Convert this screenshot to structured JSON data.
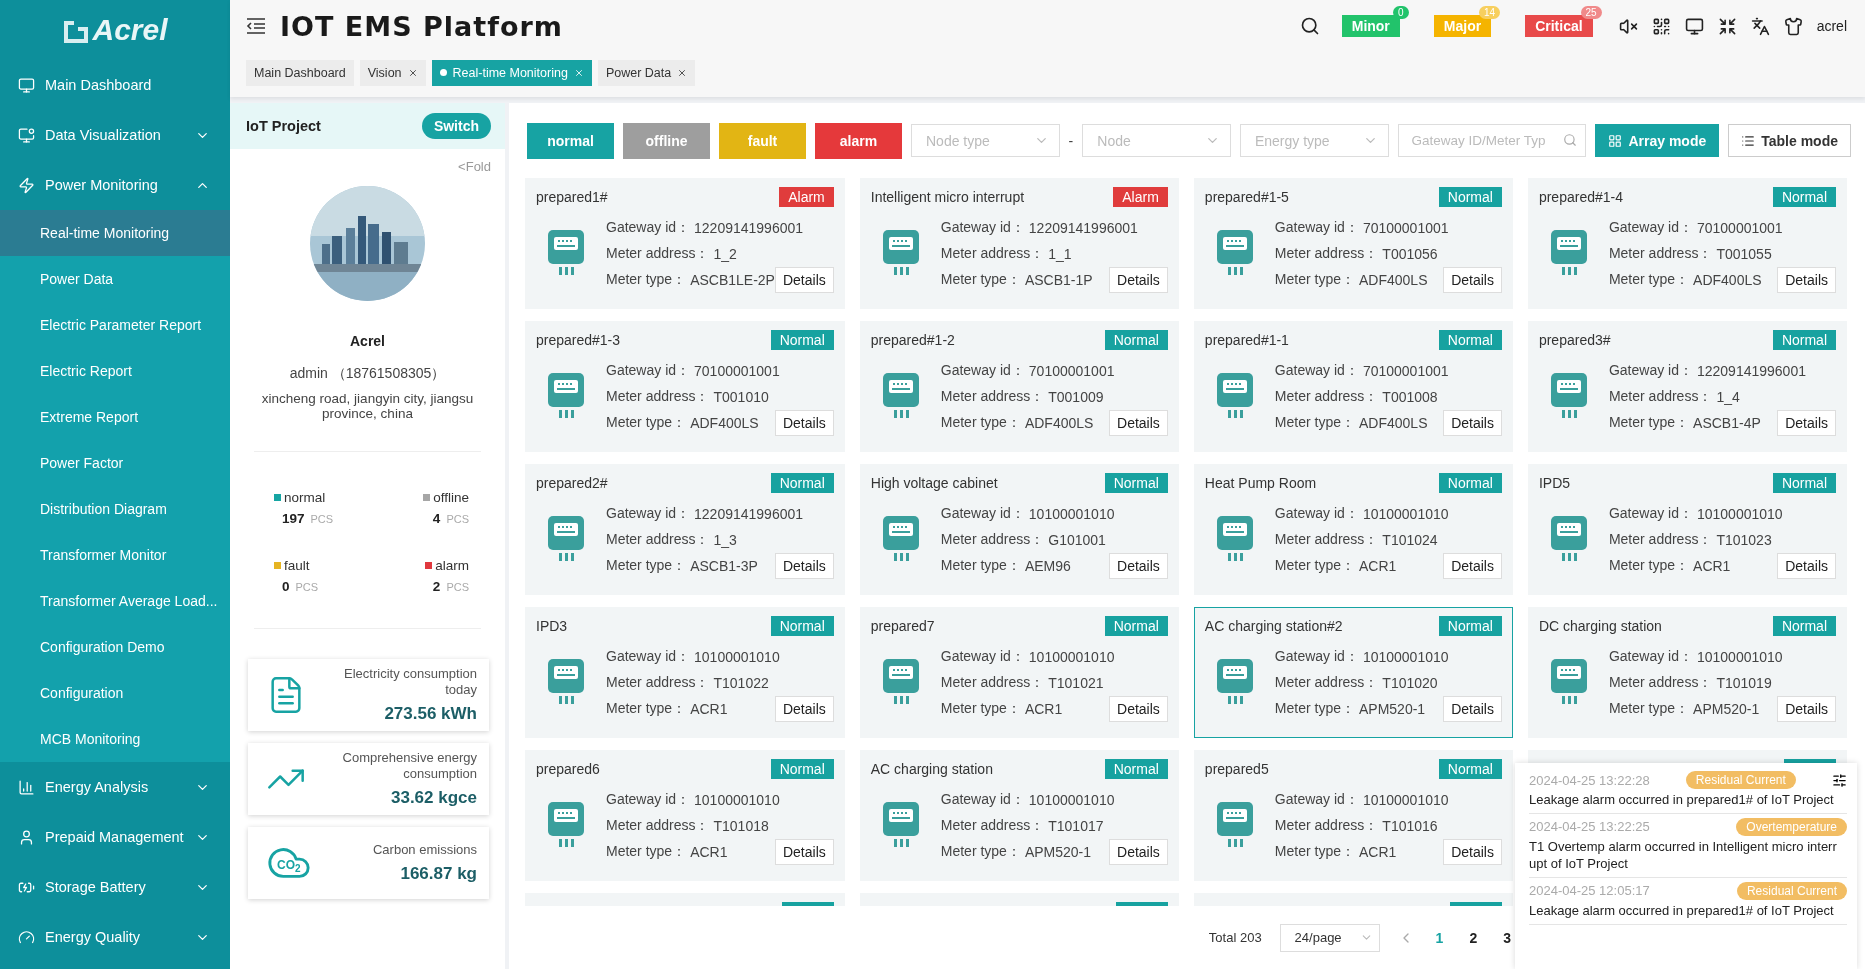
{
  "sidebar": {
    "logo": "Acrel",
    "items": [
      {
        "label": "Main Dashboard",
        "kind": "link"
      },
      {
        "label": "Data Visualization",
        "kind": "group",
        "expanded": false
      },
      {
        "label": "Power Monitoring",
        "kind": "group",
        "expanded": true,
        "children": [
          {
            "label": "Real-time Monitoring",
            "selected": true
          },
          {
            "label": "Power Data",
            "selected": false
          },
          {
            "label": "Electric Parameter Report",
            "selected": false
          },
          {
            "label": "Electric Report",
            "selected": false
          },
          {
            "label": "Extreme Report",
            "selected": false
          },
          {
            "label": "Power Factor",
            "selected": false
          },
          {
            "label": "Distribution Diagram",
            "selected": false
          },
          {
            "label": "Transformer Monitor",
            "selected": false
          },
          {
            "label": "Transformer Average Load...",
            "selected": false
          },
          {
            "label": "Configuration Demo",
            "selected": false
          },
          {
            "label": "Configuration",
            "selected": false
          },
          {
            "label": "MCB Monitoring",
            "selected": false
          }
        ]
      },
      {
        "label": "Energy Analysis",
        "kind": "group",
        "expanded": false
      },
      {
        "label": "Prepaid Management",
        "kind": "group",
        "expanded": false
      },
      {
        "label": "Storage Battery",
        "kind": "group",
        "expanded": false
      },
      {
        "label": "Energy Quality",
        "kind": "group",
        "expanded": false
      }
    ]
  },
  "header": {
    "title": "IOT EMS Platform",
    "alarms": [
      {
        "kind": "minor",
        "label": "Minor",
        "count": "0"
      },
      {
        "kind": "major",
        "label": "Major",
        "count": "14"
      },
      {
        "kind": "critical",
        "label": "Critical",
        "count": "25"
      }
    ],
    "user": "acrel"
  },
  "tabs": [
    {
      "label": "Main Dashboard",
      "selected": false,
      "closable": false
    },
    {
      "label": "Vision",
      "selected": false,
      "closable": true
    },
    {
      "label": "Real-time Monitoring",
      "selected": true,
      "closable": true
    },
    {
      "label": "Power Data",
      "selected": false,
      "closable": true
    }
  ],
  "project": {
    "title": "IoT Project",
    "switch": "Switch",
    "fold": "<Fold",
    "name": "Acrel",
    "contact": "admin （18761508305）",
    "address": "xincheng road, jiangyin city, jiangsu province, china",
    "counts": [
      {
        "label": "normal",
        "color": "#16a5a3",
        "value": "197",
        "unit": "PCS"
      },
      {
        "label": "offline",
        "color": "#a6a6a6",
        "value": "4",
        "unit": "PCS"
      },
      {
        "label": "fault",
        "color": "#e6b422",
        "value": "0",
        "unit": "PCS"
      },
      {
        "label": "alarm",
        "color": "#e0383e",
        "value": "2",
        "unit": "PCS"
      }
    ],
    "stats": [
      {
        "kind": "electricity",
        "label": "Electricity consumption today",
        "value": "273.56 kWh"
      },
      {
        "kind": "energy",
        "label": "Comprehensive energy consumption",
        "value": "33.62 kgce"
      },
      {
        "kind": "carbon",
        "label": "Carbon emissions",
        "value": "166.87 kg",
        "icon_text": "CO$_{2}$"
      }
    ]
  },
  "filters": {
    "status_buttons": [
      {
        "kind": "normal",
        "label": "normal"
      },
      {
        "kind": "offline",
        "label": "offline"
      },
      {
        "kind": "fault",
        "label": "fault"
      },
      {
        "kind": "alarm",
        "label": "alarm"
      }
    ],
    "node_type": {
      "placeholder": "Node type"
    },
    "separator": "-",
    "node": {
      "placeholder": "Node"
    },
    "energy_type": {
      "placeholder": "Energy type"
    },
    "search": {
      "placeholder": "Gateway ID/Meter Typ"
    },
    "modes": [
      {
        "label": "Array mode",
        "selected": true
      },
      {
        "label": "Table mode",
        "selected": false
      }
    ]
  },
  "cards": [
    {
      "title": "prepared1#",
      "status": {
        "kind": "alarm",
        "label": "Alarm"
      },
      "selected": false,
      "fields": [
        {
          "label": "Gateway id：",
          "value": "12209141996001"
        },
        {
          "label": "Meter address：",
          "value": "1_2"
        },
        {
          "label": "Meter type：",
          "value": "ASCB1LE-2P"
        }
      ],
      "button": "Details"
    },
    {
      "title": "Intelligent micro interrupt",
      "status": {
        "kind": "alarm",
        "label": "Alarm"
      },
      "selected": false,
      "fields": [
        {
          "label": "Gateway id：",
          "value": "12209141996001"
        },
        {
          "label": "Meter address：",
          "value": "1_1"
        },
        {
          "label": "Meter type：",
          "value": "ASCB1-1P"
        }
      ],
      "button": "Details"
    },
    {
      "title": "prepared#1-5",
      "status": {
        "kind": "normal",
        "label": "Normal"
      },
      "selected": false,
      "fields": [
        {
          "label": "Gateway id：",
          "value": "70100001001"
        },
        {
          "label": "Meter address：",
          "value": "T001056"
        },
        {
          "label": "Meter type：",
          "value": "ADF400LS"
        }
      ],
      "button": "Details"
    },
    {
      "title": "prepared#1-4",
      "status": {
        "kind": "normal",
        "label": "Normal"
      },
      "selected": false,
      "fields": [
        {
          "label": "Gateway id：",
          "value": "70100001001"
        },
        {
          "label": "Meter address：",
          "value": "T001055"
        },
        {
          "label": "Meter type：",
          "value": "ADF400LS"
        }
      ],
      "button": "Details"
    },
    {
      "title": "prepared#1-3",
      "status": {
        "kind": "normal",
        "label": "Normal"
      },
      "selected": false,
      "fields": [
        {
          "label": "Gateway id：",
          "value": "70100001001"
        },
        {
          "label": "Meter address：",
          "value": "T001010"
        },
        {
          "label": "Meter type：",
          "value": "ADF400LS"
        }
      ],
      "button": "Details"
    },
    {
      "title": "prepared#1-2",
      "status": {
        "kind": "normal",
        "label": "Normal"
      },
      "selected": false,
      "fields": [
        {
          "label": "Gateway id：",
          "value": "70100001001"
        },
        {
          "label": "Meter address：",
          "value": "T001009"
        },
        {
          "label": "Meter type：",
          "value": "ADF400LS"
        }
      ],
      "button": "Details"
    },
    {
      "title": "prepared#1-1",
      "status": {
        "kind": "normal",
        "label": "Normal"
      },
      "selected": false,
      "fields": [
        {
          "label": "Gateway id：",
          "value": "70100001001"
        },
        {
          "label": "Meter address：",
          "value": "T001008"
        },
        {
          "label": "Meter type：",
          "value": "ADF400LS"
        }
      ],
      "button": "Details"
    },
    {
      "title": "prepared3#",
      "status": {
        "kind": "normal",
        "label": "Normal"
      },
      "selected": false,
      "fields": [
        {
          "label": "Gateway id：",
          "value": "12209141996001"
        },
        {
          "label": "Meter address：",
          "value": "1_4"
        },
        {
          "label": "Meter type：",
          "value": "ASCB1-4P"
        }
      ],
      "button": "Details"
    },
    {
      "title": "prepared2#",
      "status": {
        "kind": "normal",
        "label": "Normal"
      },
      "selected": false,
      "fields": [
        {
          "label": "Gateway id：",
          "value": "12209141996001"
        },
        {
          "label": "Meter address：",
          "value": "1_3"
        },
        {
          "label": "Meter type：",
          "value": "ASCB1-3P"
        }
      ],
      "button": "Details"
    },
    {
      "title": "High voltage cabinet",
      "status": {
        "kind": "normal",
        "label": "Normal"
      },
      "selected": false,
      "fields": [
        {
          "label": "Gateway id：",
          "value": "10100001010"
        },
        {
          "label": "Meter address：",
          "value": "G101001"
        },
        {
          "label": "Meter type：",
          "value": "AEM96"
        }
      ],
      "button": "Details"
    },
    {
      "title": "Heat Pump Room",
      "status": {
        "kind": "normal",
        "label": "Normal"
      },
      "selected": false,
      "fields": [
        {
          "label": "Gateway id：",
          "value": "10100001010"
        },
        {
          "label": "Meter address：",
          "value": "T101024"
        },
        {
          "label": "Meter type：",
          "value": "ACR1"
        }
      ],
      "button": "Details"
    },
    {
      "title": "IPD5",
      "status": {
        "kind": "normal",
        "label": "Normal"
      },
      "selected": false,
      "fields": [
        {
          "label": "Gateway id：",
          "value": "10100001010"
        },
        {
          "label": "Meter address：",
          "value": "T101023"
        },
        {
          "label": "Meter type：",
          "value": "ACR1"
        }
      ],
      "button": "Details"
    },
    {
      "title": "IPD3",
      "status": {
        "kind": "normal",
        "label": "Normal"
      },
      "selected": false,
      "fields": [
        {
          "label": "Gateway id：",
          "value": "10100001010"
        },
        {
          "label": "Meter address：",
          "value": "T101022"
        },
        {
          "label": "Meter type：",
          "value": "ACR1"
        }
      ],
      "button": "Details"
    },
    {
      "title": "prepared7",
      "status": {
        "kind": "normal",
        "label": "Normal"
      },
      "selected": false,
      "fields": [
        {
          "label": "Gateway id：",
          "value": "10100001010"
        },
        {
          "label": "Meter address：",
          "value": "T101021"
        },
        {
          "label": "Meter type：",
          "value": "ACR1"
        }
      ],
      "button": "Details"
    },
    {
      "title": "AC charging station#2",
      "status": {
        "kind": "normal",
        "label": "Normal"
      },
      "selected": true,
      "fields": [
        {
          "label": "Gateway id：",
          "value": "10100001010"
        },
        {
          "label": "Meter address：",
          "value": "T101020"
        },
        {
          "label": "Meter type：",
          "value": "APM520-1"
        }
      ],
      "button": "Details"
    },
    {
      "title": "DC charging station",
      "status": {
        "kind": "normal",
        "label": "Normal"
      },
      "selected": false,
      "fields": [
        {
          "label": "Gateway id：",
          "value": "10100001010"
        },
        {
          "label": "Meter address：",
          "value": "T101019"
        },
        {
          "label": "Meter type：",
          "value": "APM520-1"
        }
      ],
      "button": "Details"
    },
    {
      "title": "prepared6",
      "status": {
        "kind": "normal",
        "label": "Normal"
      },
      "selected": false,
      "fields": [
        {
          "label": "Gateway id：",
          "value": "10100001010"
        },
        {
          "label": "Meter address：",
          "value": "T101018"
        },
        {
          "label": "Meter type：",
          "value": "ACR1"
        }
      ],
      "button": "Details"
    },
    {
      "title": "AC charging station",
      "status": {
        "kind": "normal",
        "label": "Normal"
      },
      "selected": false,
      "fields": [
        {
          "label": "Gateway id：",
          "value": "10100001010"
        },
        {
          "label": "Meter address：",
          "value": "T101017"
        },
        {
          "label": "Meter type：",
          "value": "APM520-1"
        }
      ],
      "button": "Details"
    },
    {
      "title": "prepared5",
      "status": {
        "kind": "normal",
        "label": "Normal"
      },
      "selected": false,
      "fields": [
        {
          "label": "Gateway id：",
          "value": "10100001010"
        },
        {
          "label": "Meter address：",
          "value": "T101016"
        },
        {
          "label": "Meter type：",
          "value": "ACR1"
        }
      ],
      "button": "Details"
    },
    {
      "status": {
        "kind": "normal"
      },
      "selected": false,
      "partial": true
    },
    {
      "status": {
        "kind": "normal"
      },
      "selected": false,
      "partial": true
    },
    {
      "status": {
        "kind": "normal"
      },
      "selected": false,
      "partial": true
    },
    {
      "status": {
        "kind": "normal"
      },
      "selected": false,
      "partial": true
    }
  ],
  "pagination": {
    "total": "Total 203",
    "page_size": "24/page",
    "pages": [
      {
        "label": "1",
        "selected": true
      },
      {
        "label": "2",
        "selected": false
      },
      {
        "label": "3",
        "selected": false
      }
    ]
  },
  "notifications": [
    {
      "time": "2024-04-25 13:22:28",
      "tag": "Residual Current",
      "message": "Leakage alarm occurred in prepared1# of IoT Project"
    },
    {
      "time": "2024-04-25 13:22:25",
      "tag": "Overtemperature",
      "message": "T1 Overtemp alarm occurred in Intelligent micro interrupt of IoT Project"
    },
    {
      "time": "2024-04-25 12:05:17",
      "tag": "Residual Current",
      "message": "Leakage alarm occurred in prepared1# of IoT Project"
    }
  ]
}
